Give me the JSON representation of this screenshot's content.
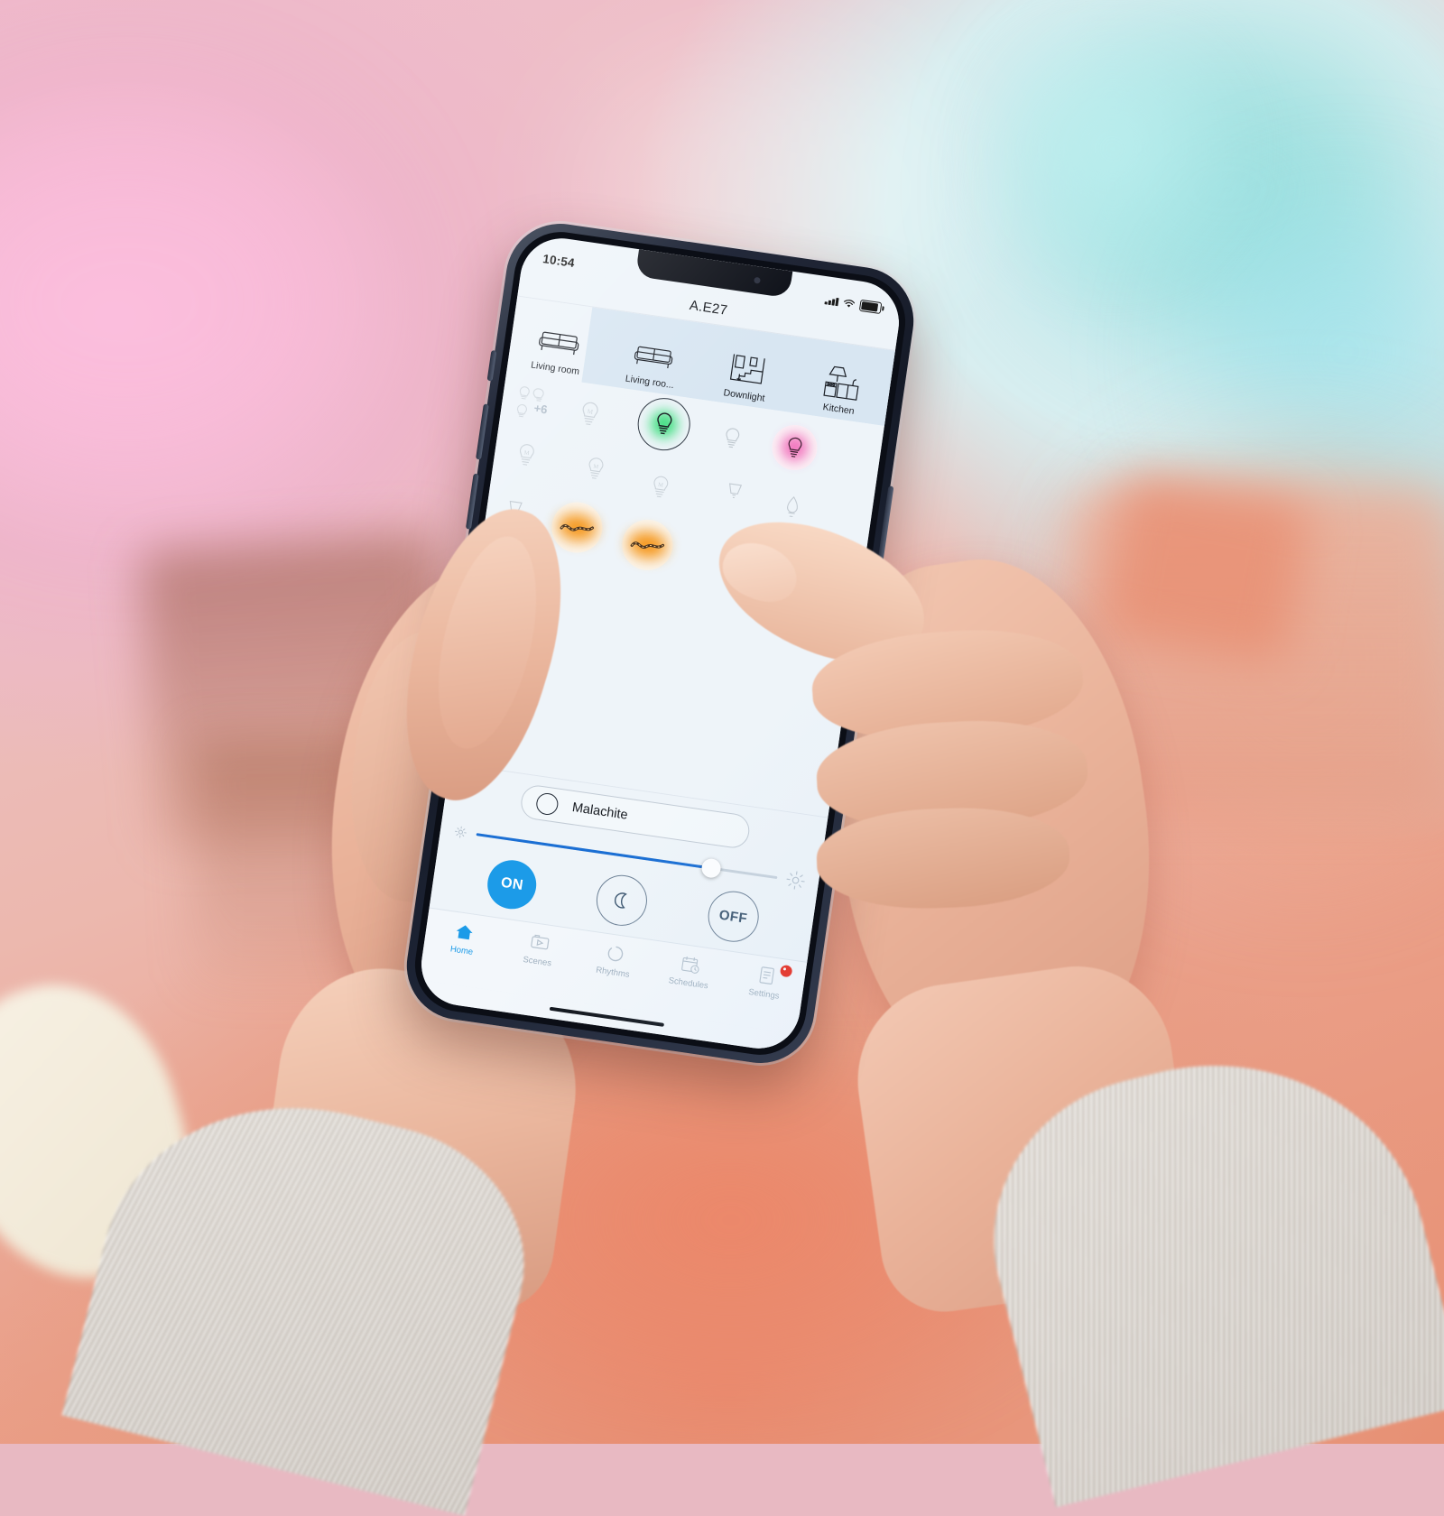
{
  "scene": {
    "description": "Hands holding a smartphone running a smart-lighting app in a pink-lit living room",
    "background_colors": {
      "pink": "#eeb6ca",
      "teal": "#bfe6ea",
      "coral_floor": "#e78d70",
      "sleeve_gray": "#ded8d0"
    }
  },
  "phone": {
    "status_bar": {
      "time": "10:54",
      "signal_icon": "signal-bars-icon",
      "wifi_icon": "wifi-icon",
      "battery_icon": "battery-icon",
      "battery_level": 80
    },
    "nav": {
      "title": "A.E27"
    },
    "room_tabs": [
      {
        "label": "Living room",
        "icon": "sofa-icon",
        "selected": false
      },
      {
        "label": "Living roo...",
        "icon": "sofa-icon",
        "selected": true
      },
      {
        "label": "Downlight",
        "icon": "floorplan-icon",
        "selected": true
      },
      {
        "label": "Kitchen",
        "icon": "kitchen-icon",
        "selected": true
      }
    ],
    "overflow_count": "+6",
    "bulbs": [
      {
        "icon": "bulb-m-icon",
        "state": "off",
        "color": null,
        "selected": false
      },
      {
        "icon": "bulb-icon",
        "state": "on",
        "color": "#37dd7a",
        "selected": true
      },
      {
        "icon": "bulb-icon",
        "state": "off",
        "color": null,
        "selected": false
      },
      {
        "icon": "bulb-icon",
        "state": "on",
        "color": "#f060b4",
        "selected": false
      },
      {
        "icon": "bulb-m-icon",
        "state": "off",
        "color": null,
        "selected": false
      },
      {
        "icon": "bulb-m-icon",
        "state": "off",
        "color": null,
        "selected": false
      },
      {
        "icon": "bulb-m-icon",
        "state": "off",
        "color": null,
        "selected": false
      },
      {
        "icon": "spot-icon",
        "state": "off",
        "color": null,
        "selected": false
      },
      {
        "icon": "candle-icon",
        "state": "off",
        "color": null,
        "selected": false
      },
      {
        "icon": "spot-icon",
        "state": "off",
        "color": null,
        "selected": false
      },
      {
        "icon": "lightstrip-icon",
        "state": "on",
        "color": "#f59312",
        "selected": false
      },
      {
        "icon": "lightstrip-icon",
        "state": "on",
        "color": "#f59312",
        "selected": false
      }
    ],
    "scene": {
      "name": "Malachite",
      "swatch_color": "#3fe07f",
      "swatch_icon": "color-ring-icon"
    },
    "brightness": {
      "low_icon": "brightness-low-icon",
      "high_icon": "brightness-high-icon",
      "value": 78,
      "track_color": "#1b6fd4"
    },
    "power_buttons": [
      {
        "label": "ON",
        "name": "on-button",
        "style": "filled",
        "color": "#1c9be8"
      },
      {
        "label": "",
        "name": "night-mode-button",
        "style": "outline",
        "icon": "moon-icon"
      },
      {
        "label": "OFF",
        "name": "off-button",
        "style": "outline"
      }
    ],
    "tab_bar": [
      {
        "label": "Home",
        "icon": "home-icon",
        "active": true,
        "badge": false
      },
      {
        "label": "Scenes",
        "icon": "scenes-icon",
        "active": false,
        "badge": false
      },
      {
        "label": "Rhythms",
        "icon": "rhythms-icon",
        "active": false,
        "badge": false
      },
      {
        "label": "Schedules",
        "icon": "schedules-icon",
        "active": false,
        "badge": false
      },
      {
        "label": "Settings",
        "icon": "settings-icon",
        "active": false,
        "badge": true
      }
    ]
  }
}
